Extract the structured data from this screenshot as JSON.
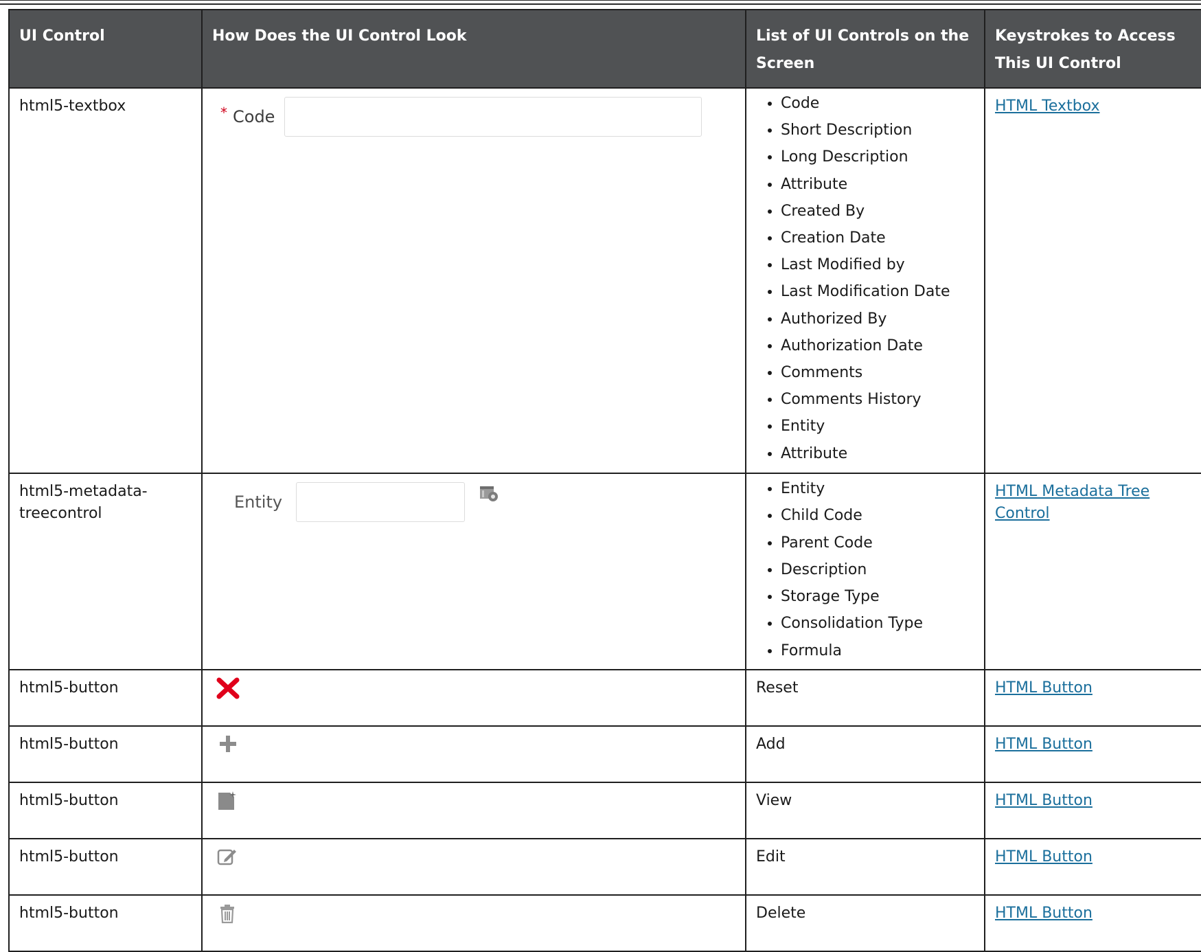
{
  "header": {
    "col1": "UI Control",
    "col2": "How Does the UI Control Look",
    "col3_line1": "List of UI Controls on the",
    "col3_line2": "Screen",
    "col4_line1": "Keystrokes to Access",
    "col4_line2": "This UI Control"
  },
  "rows": [
    {
      "control": "html5-textbox",
      "preview": {
        "required_marker": "*",
        "label": "Code",
        "value": ""
      },
      "controls": [
        "Code",
        "Short Description",
        "Long Description",
        "Attribute",
        "Created By",
        "Creation Date",
        "Last Modified by",
        "Last Modification Date",
        "Authorized By",
        "Authorization Date",
        "Comments",
        "Comments History",
        "Entity",
        "Attribute"
      ],
      "link": "HTML Textbox"
    },
    {
      "control_line1": "html5-metadata-",
      "control_line2": "treecontrol",
      "preview": {
        "label": "Entity",
        "value": "",
        "icon": "tree-browse-icon"
      },
      "controls": [
        "Entity",
        "Child Code",
        "Parent Code",
        "Description",
        "Storage Type",
        "Consolidation Type",
        "Formula"
      ],
      "link_line1": "HTML Metadata Tree",
      "link_line2": "Control"
    },
    {
      "control": "html5-button",
      "icon": "red-x-icon",
      "controls": "Reset",
      "link": "HTML Button"
    },
    {
      "control": "html5-button",
      "icon": "plus-icon",
      "controls": "Add",
      "link": "HTML Button"
    },
    {
      "control": "html5-button",
      "icon": "new-document-icon",
      "controls": "View",
      "link": "HTML Button"
    },
    {
      "control": "html5-button",
      "icon": "edit-pencil-icon",
      "controls": "Edit",
      "link": "HTML Button"
    },
    {
      "control": "html5-button",
      "icon": "trash-icon",
      "controls": "Delete",
      "link": "HTML Button"
    }
  ],
  "colors": {
    "header_bg": "#505254",
    "link": "#1b6f9c",
    "required": "#d0021b",
    "reset_icon": "#e0001b"
  }
}
